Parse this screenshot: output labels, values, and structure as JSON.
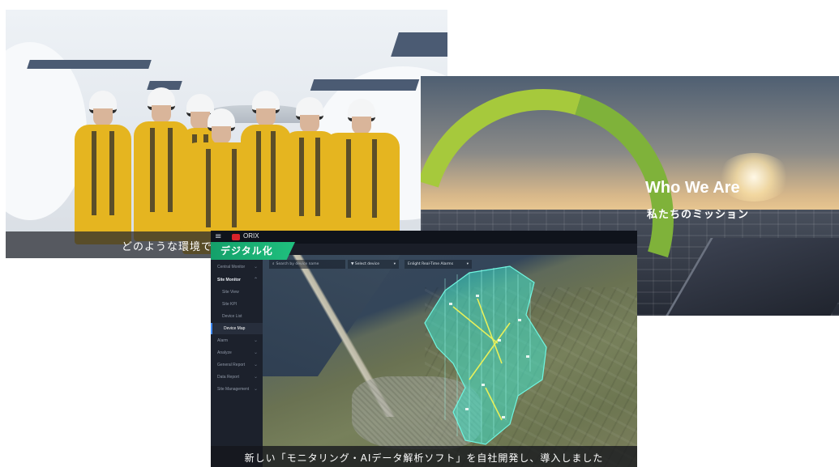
{
  "photo_card": {
    "caption": "どのような環境で"
  },
  "mission_card": {
    "title": "Who We Are",
    "subtitle": "私たちのミッション",
    "accent_color": "#a6c93c"
  },
  "app_card": {
    "brand": "ORIX",
    "menu_icon": "≡",
    "badge": "デジタル化",
    "badge_color": "#1fc07e",
    "search_placeholder": "Search by device name",
    "filter_device": "Select device",
    "filter_alarms": "Enlight Real-Time Alarms",
    "sidebar": {
      "items": [
        {
          "label": "Central Monitor",
          "level": "top",
          "chevron": true
        },
        {
          "label": "Site Monitor",
          "level": "top",
          "bold": true,
          "chevron": true
        },
        {
          "label": "Site View",
          "level": "sub"
        },
        {
          "label": "Site KPI",
          "level": "sub"
        },
        {
          "label": "Device List",
          "level": "sub"
        },
        {
          "label": "Device Map",
          "level": "sub",
          "active": true
        },
        {
          "label": "Alarm",
          "level": "top",
          "chevron": true
        },
        {
          "label": "Analyze",
          "level": "top",
          "chevron": true
        },
        {
          "label": "General Report",
          "level": "top",
          "chevron": true
        },
        {
          "label": "Data Report",
          "level": "top",
          "chevron": true
        },
        {
          "label": "Site Management",
          "level": "top",
          "chevron": true
        }
      ]
    },
    "caption": "新しい「モニタリング・AIデータ解析ソフト」を自社開発し、導入しました",
    "overlay_color": "#3fe0c8"
  }
}
